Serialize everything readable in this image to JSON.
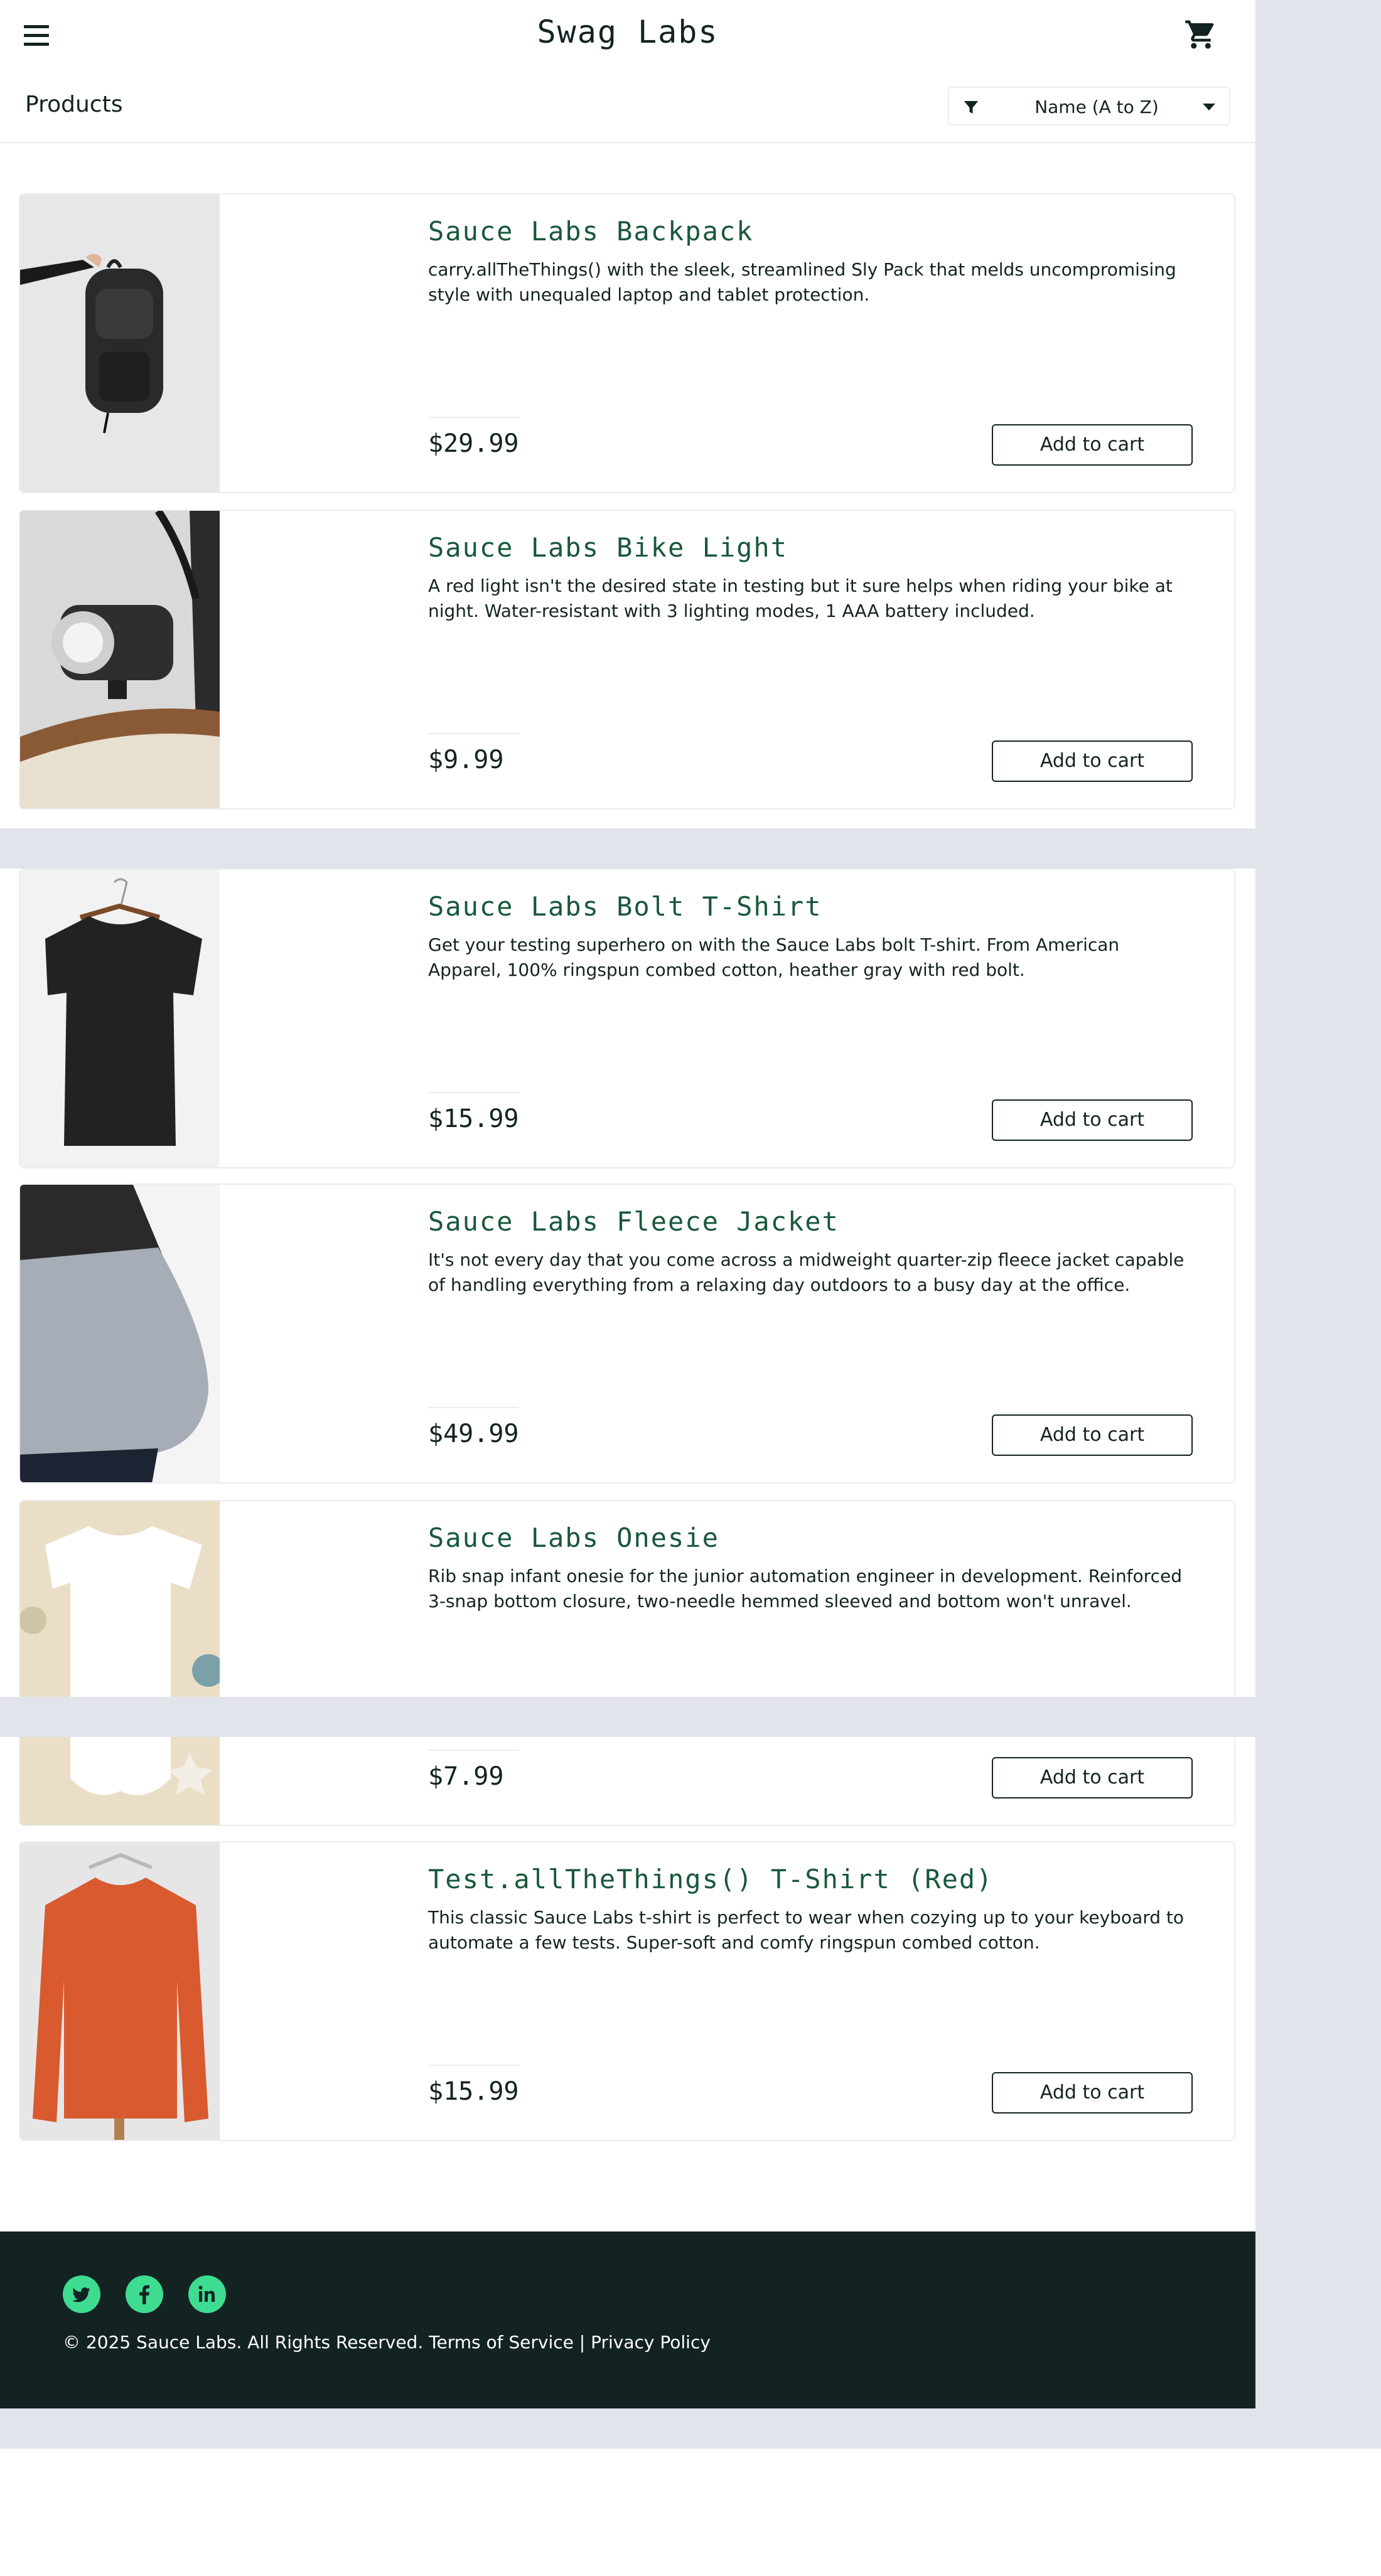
{
  "header": {
    "title": "Swag Labs",
    "menu_icon": "hamburger-menu-icon",
    "cart_icon": "shopping-cart-icon"
  },
  "subheader": {
    "title": "Products",
    "sort": {
      "selected": "Name (A to Z)",
      "icon": "filter-icon"
    }
  },
  "products": [
    {
      "name": "Sauce Labs Backpack",
      "description": "carry.allTheThings() with the sleek, streamlined Sly Pack that melds uncompromising style with unequaled laptop and tablet protection.",
      "price": "$29.99",
      "button": "Add to cart"
    },
    {
      "name": "Sauce Labs Bike Light",
      "description": "A red light isn't the desired state in testing but it sure helps when riding your bike at night. Water-resistant with 3 lighting modes, 1 AAA battery included.",
      "price": "$9.99",
      "button": "Add to cart"
    },
    {
      "name": "Sauce Labs Bolt T-Shirt",
      "description": "Get your testing superhero on with the Sauce Labs bolt T-shirt. From American Apparel, 100% ringspun combed cotton, heather gray with red bolt.",
      "price": "$15.99",
      "button": "Add to cart"
    },
    {
      "name": "Sauce Labs Fleece Jacket",
      "description": "It's not every day that you come across a midweight quarter-zip fleece jacket capable of handling everything from a relaxing day outdoors to a busy day at the office.",
      "price": "$49.99",
      "button": "Add to cart"
    },
    {
      "name": "Sauce Labs Onesie",
      "description": "Rib snap infant onesie for the junior automation engineer in development. Reinforced 3-snap bottom closure, two-needle hemmed sleeved and bottom won't unravel.",
      "price": "$7.99",
      "button": "Add to cart"
    },
    {
      "name": "Test.allTheThings() T-Shirt (Red)",
      "description": "This classic Sauce Labs t-shirt is perfect to wear when cozying up to your keyboard to automate a few tests. Super-soft and comfy ringspun combed cotton.",
      "price": "$15.99",
      "button": "Add to cart"
    }
  ],
  "footer": {
    "social": [
      "twitter-icon",
      "facebook-icon",
      "linkedin-icon"
    ],
    "copy": "© 2025 Sauce Labs. All Rights Reserved. Terms of Service | Privacy Policy"
  },
  "colors": {
    "accent_green": "#18583a",
    "social_green": "#3ddc91",
    "footer_bg": "#132322",
    "seam_gray": "#e2e4ec"
  }
}
